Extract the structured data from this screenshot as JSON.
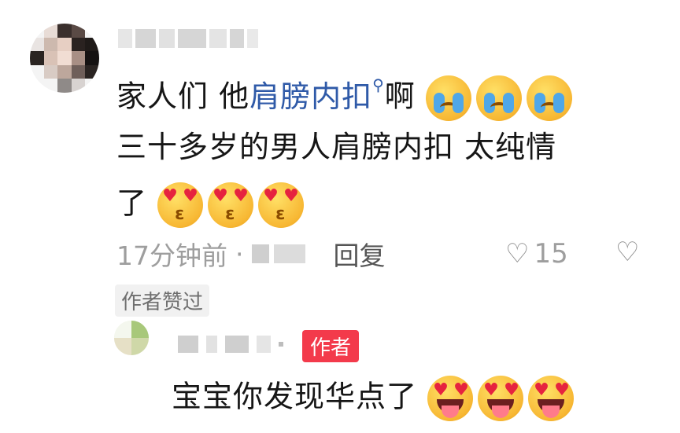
{
  "comment": {
    "line1_prefix": "家人们 他",
    "line1_link": "肩膀内扣",
    "line1_suffix": "啊",
    "line2": "三十多岁的男人肩膀内扣 太纯情",
    "line3": "了",
    "line1_emojis": [
      "crying-face",
      "crying-face",
      "crying-face"
    ],
    "line3_emojis": [
      "kissing-heart-eyes-face",
      "kissing-heart-eyes-face",
      "kissing-heart-eyes-face"
    ],
    "time": "17分钟前",
    "separator": "·",
    "reply_label": "回复",
    "like_count": "15",
    "author_liked_badge": "作者赞过"
  },
  "reply": {
    "author_tag": "作者",
    "text": "宝宝你发现华点了",
    "emojis": [
      "heart-eyes-tongue-face",
      "heart-eyes-tongue-face",
      "heart-eyes-tongue-face"
    ]
  },
  "colors": {
    "link": "#2f5aa8",
    "meta": "#9e9e9e",
    "author_tag_bg": "#f33a4b"
  }
}
